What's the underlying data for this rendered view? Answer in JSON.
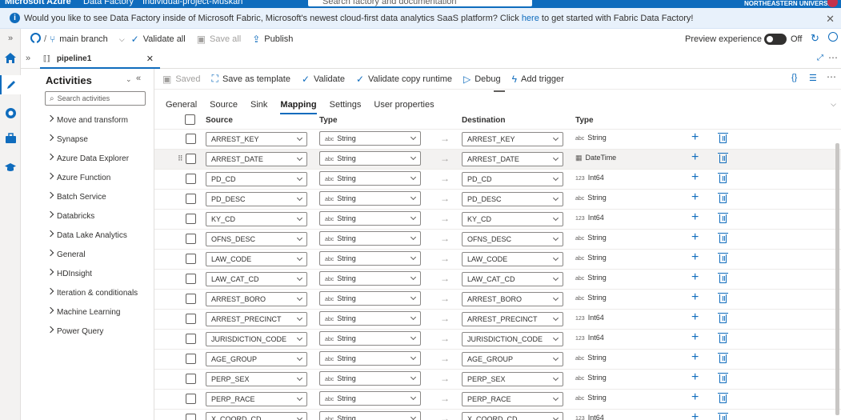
{
  "topbar": {
    "brand": "Microsoft Azure",
    "service": "Data Factory",
    "project": "Individual-project-Muskan",
    "search_placeholder": "Search factory and documentation",
    "org": "NORTHEASTERN UNIVERSITY"
  },
  "banner": {
    "text_before": "Would you like to see Data Factory inside of Microsoft Fabric, Microsoft's newest cloud-first data analytics SaaS platform? Click ",
    "link": "here",
    "text_after": " to get started with Fabric Data Factory!"
  },
  "toolbar1": {
    "branch": "main branch",
    "validate_all": "Validate all",
    "save_all": "Save all",
    "publish": "Publish",
    "preview": "Preview experience",
    "toggle_state": "Off"
  },
  "tab": {
    "name": "pipeline1"
  },
  "activities": {
    "title": "Activities",
    "search_placeholder": "Search activities",
    "items": [
      "Move and transform",
      "Synapse",
      "Azure Data Explorer",
      "Azure Function",
      "Batch Service",
      "Databricks",
      "Data Lake Analytics",
      "General",
      "HDInsight",
      "Iteration & conditionals",
      "Machine Learning",
      "Power Query"
    ]
  },
  "toolbar2": {
    "saved": "Saved",
    "save_template": "Save as template",
    "validate": "Validate",
    "validate_copy": "Validate copy runtime",
    "debug": "Debug",
    "add_trigger": "Add trigger"
  },
  "subtabs": [
    "General",
    "Source",
    "Sink",
    "Mapping",
    "Settings",
    "User properties"
  ],
  "grid": {
    "headers": {
      "source": "Source",
      "type": "Type",
      "destination": "Destination",
      "dtype": "Type"
    },
    "rows": [
      {
        "source": "ARREST_KEY",
        "type": "String",
        "dest": "ARREST_KEY",
        "dtype": "String",
        "dbadge": "abc"
      },
      {
        "source": "ARREST_DATE",
        "type": "String",
        "dest": "ARREST_DATE",
        "dtype": "DateTime",
        "dbadge": "cal"
      },
      {
        "source": "PD_CD",
        "type": "String",
        "dest": "PD_CD",
        "dtype": "Int64",
        "dbadge": "123"
      },
      {
        "source": "PD_DESC",
        "type": "String",
        "dest": "PD_DESC",
        "dtype": "String",
        "dbadge": "abc"
      },
      {
        "source": "KY_CD",
        "type": "String",
        "dest": "KY_CD",
        "dtype": "Int64",
        "dbadge": "123"
      },
      {
        "source": "OFNS_DESC",
        "type": "String",
        "dest": "OFNS_DESC",
        "dtype": "String",
        "dbadge": "abc"
      },
      {
        "source": "LAW_CODE",
        "type": "String",
        "dest": "LAW_CODE",
        "dtype": "String",
        "dbadge": "abc"
      },
      {
        "source": "LAW_CAT_CD",
        "type": "String",
        "dest": "LAW_CAT_CD",
        "dtype": "String",
        "dbadge": "abc"
      },
      {
        "source": "ARREST_BORO",
        "type": "String",
        "dest": "ARREST_BORO",
        "dtype": "String",
        "dbadge": "abc"
      },
      {
        "source": "ARREST_PRECINCT",
        "type": "String",
        "dest": "ARREST_PRECINCT",
        "dtype": "Int64",
        "dbadge": "123"
      },
      {
        "source": "JURISDICTION_CODE",
        "type": "String",
        "dest": "JURISDICTION_CODE",
        "dtype": "Int64",
        "dbadge": "123"
      },
      {
        "source": "AGE_GROUP",
        "type": "String",
        "dest": "AGE_GROUP",
        "dtype": "String",
        "dbadge": "abc"
      },
      {
        "source": "PERP_SEX",
        "type": "String",
        "dest": "PERP_SEX",
        "dtype": "String",
        "dbadge": "abc"
      },
      {
        "source": "PERP_RACE",
        "type": "String",
        "dest": "PERP_RACE",
        "dtype": "String",
        "dbadge": "abc"
      },
      {
        "source": "X_COORD_CD",
        "type": "String",
        "dest": "X_COORD_CD",
        "dtype": "Int64",
        "dbadge": "123"
      }
    ]
  },
  "colors": {
    "accent": "#0f6cbd",
    "topbar": "#0f6cbd",
    "banner": "#e8f1fb"
  }
}
